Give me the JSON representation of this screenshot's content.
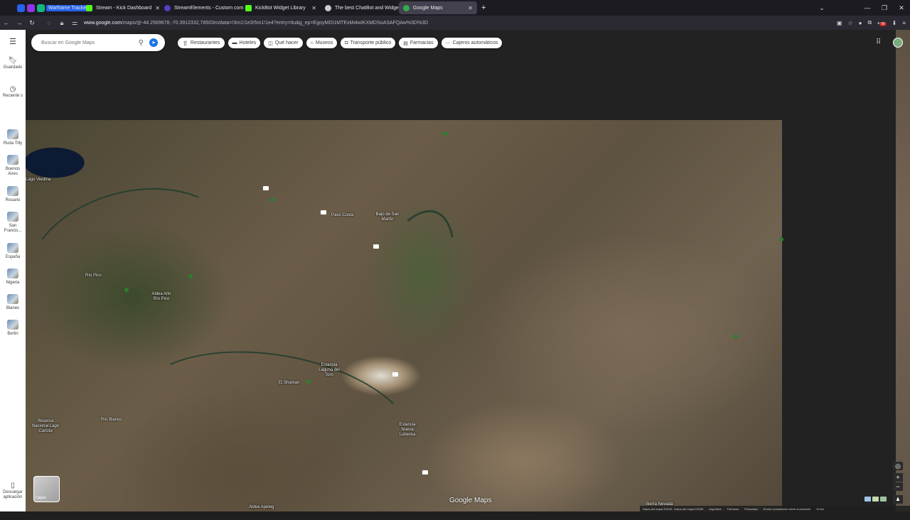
{
  "browser": {
    "tabs": [
      {
        "label": "Warframe Tracker",
        "color": "#2563eb"
      },
      {
        "label": "Stream - Kick Dashboard",
        "color": "#53fc18"
      },
      {
        "label": "StreamElements - Custom com",
        "color": "#5b3cc4"
      },
      {
        "label": "KickBot Widget Library",
        "color": "#53fc18"
      },
      {
        "label": "The best ChatBot and Widgets",
        "color": "#cccccc"
      },
      {
        "label": "Google Maps",
        "color": "#34a853"
      }
    ],
    "new_tab": "+",
    "url_domain": "www.google.com",
    "url_rest": "/maps/@-44.2569678,-70.3912332,78503m/data=!3m1!1e3!5m1!1e4?entry=ttu&g_ep=EgoyMDI1MTExMi4wIKXMDSoASAFQAw%3D%3D",
    "notif_count": "99"
  },
  "sidebar": {
    "menu_icon": "menu-icon",
    "items": [
      {
        "label": "Guardado",
        "icon": "bookmark-icon"
      },
      {
        "label": "Reciente s",
        "icon": "history-icon"
      },
      {
        "label": "Ruda Tilly"
      },
      {
        "label": "Buenos Aires"
      },
      {
        "label": "Rosario"
      },
      {
        "label": "San Francis..."
      },
      {
        "label": "España"
      },
      {
        "label": "Nigeria"
      },
      {
        "label": "Blanes"
      },
      {
        "label": "Berlin"
      }
    ],
    "download_label": "Descargar aplicación"
  },
  "search": {
    "placeholder": "Buscar en Google Maps"
  },
  "chips": [
    "Restaurantes",
    "Hoteles",
    "Qué hacer",
    "Museos",
    "Transporte público",
    "Farmacias",
    "Cajeros automáticos"
  ],
  "map": {
    "places": [
      "Lago Viedma",
      "Paso Costa",
      "Bajo de San Martín",
      "Río Pico",
      "Aldea Alto Río Pico",
      "Estancia Laguna del Toro",
      "El Shaman",
      "Río Blanco",
      "Reserva Nacional Lago Carlota",
      "Estancia Nueva Lubecka",
      "Aldea Apeleg",
      "Sierra Nevada"
    ],
    "logo": "Google Maps",
    "layers_label": "Capas"
  },
  "footer": {
    "items": [
      "Datos del mapa ©2025 , Datos del mapa ©2025",
      "Argentina",
      "Términos",
      "Privacidad",
      "Enviar comentarios sobre el producto",
      "10 km"
    ]
  }
}
